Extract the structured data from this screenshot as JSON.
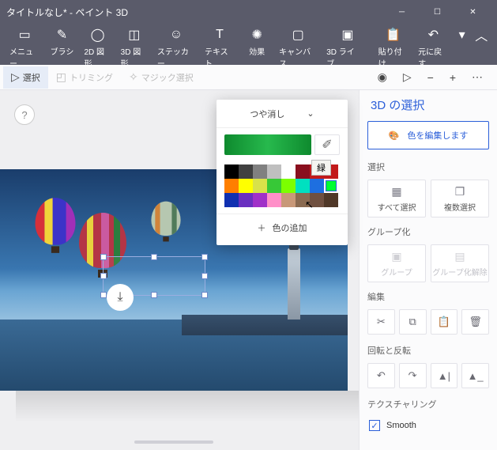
{
  "titlebar": {
    "title": "タイトルなし* - ペイント 3D"
  },
  "ribbon": {
    "menu": "メニュー",
    "brush": "ブラシ",
    "shapes2d": "2D 図形",
    "shapes3d": "3D 図形",
    "sticker": "ステッカー",
    "text": "テキスト",
    "effects": "効果",
    "canvas": "キャンバス",
    "lib3d": "3D ライブ…",
    "paste": "貼り付け",
    "undo": "元に戻す"
  },
  "toolbar": {
    "select": "選択",
    "trimming": "トリミング",
    "magic": "マジック選択"
  },
  "help": "?",
  "colorpanel": {
    "finish": "つや消し",
    "tooltip": "緑",
    "add": "色の追加",
    "rows": [
      [
        "#000000",
        "#404040",
        "#808080",
        "#bfbfbf",
        "#ffffff",
        "#8a0f1e",
        "#c21a1a",
        "#c21a1a"
      ],
      [
        "#ff7f00",
        "#ffff00",
        "#d8e24a",
        "#37c837",
        "#7cff00",
        "#00e0c0",
        "#1e6fe0",
        "#00ff30"
      ],
      [
        "#1030b0",
        "#6a2fc0",
        "#a030c8",
        "#ff8fc8",
        "#c89878",
        "#8a6a50",
        "#705040",
        "#503828"
      ]
    ]
  },
  "side": {
    "title": "3D の選択",
    "edit_colors": "色を編集します",
    "sec_select": "選択",
    "select_all": "すべて選択",
    "multi_select": "複数選択",
    "sec_group": "グループ化",
    "group": "グループ",
    "ungroup": "グループ化解除",
    "sec_edit": "編集",
    "sec_rotate": "回転と反転",
    "sec_texture": "テクスチャリング",
    "smooth": "Smooth"
  }
}
